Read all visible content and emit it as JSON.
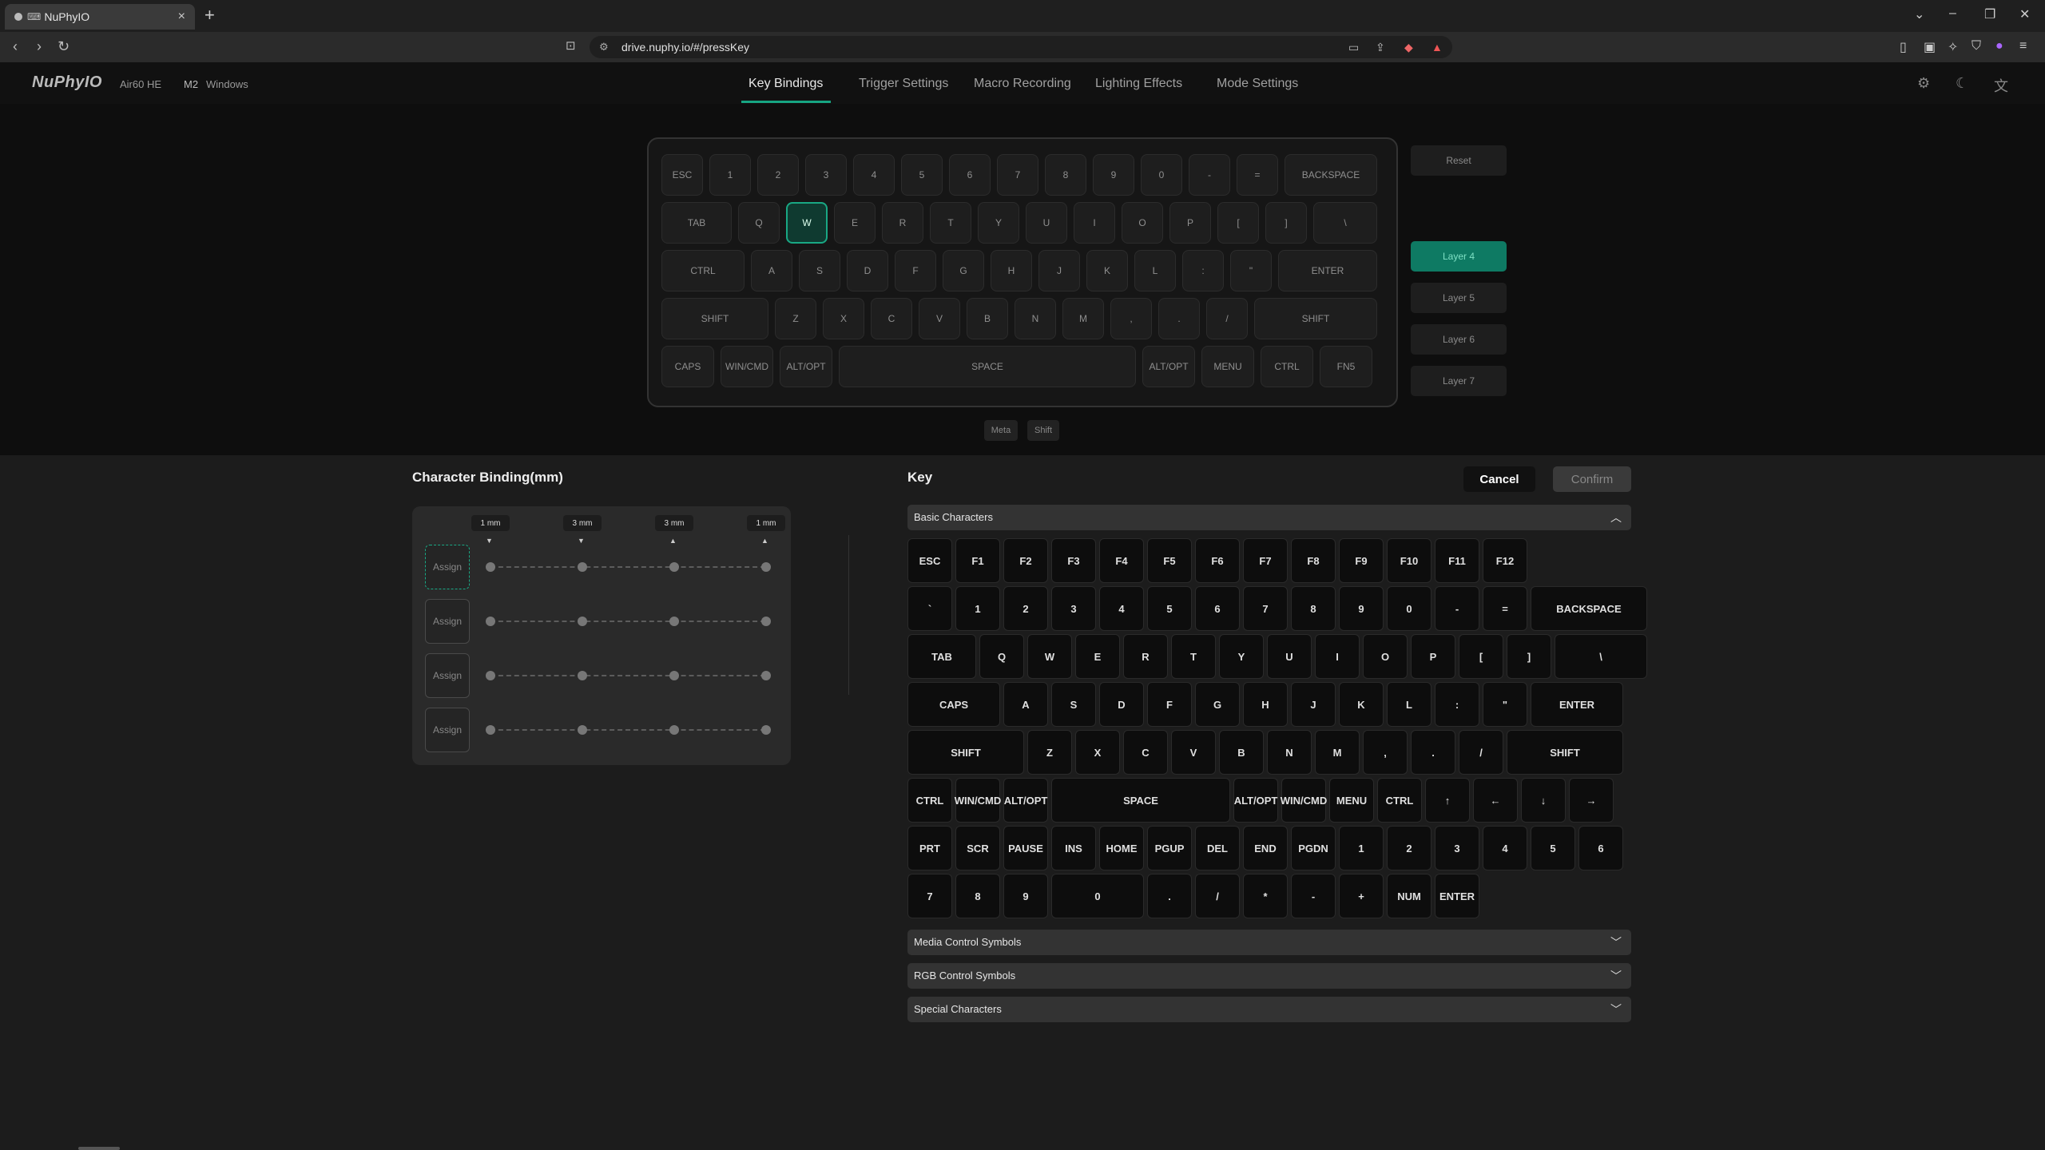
{
  "browser": {
    "tab_title": "NuPhyIO",
    "tab_kbd": "⌨",
    "url": "drive.nuphy.io/#/pressKey",
    "new_tab": "+",
    "close": "×"
  },
  "header": {
    "logo": "NuPhyIO",
    "model": "Air60 HE",
    "badge": "M2",
    "os": "Windows",
    "tabs": [
      "Key Bindings",
      "Trigger Settings",
      "Macro Recording",
      "Lighting Effects",
      "Mode Settings"
    ]
  },
  "top_keyboard": {
    "rows": [
      [
        "ESC",
        "1",
        "2",
        "3",
        "4",
        "5",
        "6",
        "7",
        "8",
        "9",
        "0",
        "-",
        "=",
        "BACKSPACE"
      ],
      [
        "TAB",
        "Q",
        "W",
        "E",
        "R",
        "T",
        "Y",
        "U",
        "I",
        "O",
        "P",
        "[",
        "]",
        "\\"
      ],
      [
        "CTRL",
        "A",
        "S",
        "D",
        "F",
        "G",
        "H",
        "J",
        "K",
        "L",
        ":",
        "\"",
        "ENTER"
      ],
      [
        "SHIFT",
        "Z",
        "X",
        "C",
        "V",
        "B",
        "N",
        "M",
        ",",
        ".",
        "/",
        "SHIFT"
      ],
      [
        "CAPS",
        "WIN/CMD",
        "ALT/OPT",
        "SPACE",
        "ALT/OPT",
        "MENU",
        "CTRL",
        "FN5"
      ]
    ],
    "selected": "W"
  },
  "side": {
    "reset": "Reset",
    "layers": [
      "Layer 4",
      "Layer 5",
      "Layer 6",
      "Layer 7"
    ]
  },
  "modifiers": [
    "Meta",
    "Shift"
  ],
  "binding": {
    "title": "Character Binding(mm)",
    "mm_labels": [
      "1 mm",
      "3 mm",
      "3 mm",
      "1 mm"
    ],
    "assign_label": "Assign",
    "slots": 4
  },
  "key": {
    "title": "Key",
    "cancel": "Cancel",
    "confirm": "Confirm",
    "sections": [
      "Basic Characters",
      "Media Control Symbols",
      "RGB Control Symbols",
      "Special Characters"
    ],
    "basic_rows": [
      [
        "ESC",
        "F1",
        "F2",
        "F3",
        "F4",
        "F5",
        "F6",
        "F7",
        "F8",
        "F9",
        "F10",
        "F11",
        "F12"
      ],
      [
        "`",
        "1",
        "2",
        "3",
        "4",
        "5",
        "6",
        "7",
        "8",
        "9",
        "0",
        "-",
        "=",
        "BACKSPACE"
      ],
      [
        "TAB",
        "Q",
        "W",
        "E",
        "R",
        "T",
        "Y",
        "U",
        "I",
        "O",
        "P",
        "[",
        "]",
        "\\"
      ],
      [
        "CAPS",
        "A",
        "S",
        "D",
        "F",
        "G",
        "H",
        "J",
        "K",
        "L",
        ":",
        "\"",
        "ENTER"
      ],
      [
        "SHIFT",
        "Z",
        "X",
        "C",
        "V",
        "B",
        "N",
        "M",
        ",",
        ".",
        "/",
        "SHIFT"
      ],
      [
        "CTRL",
        "WIN/CMD",
        "ALT/OPT",
        "SPACE",
        "ALT/OPT",
        "WIN/CMD",
        "MENU",
        "CTRL",
        "↑",
        "←",
        "↓",
        "→"
      ],
      [
        "PRT",
        "SCR",
        "PAUSE",
        "INS",
        "HOME",
        "PGUP",
        "DEL",
        "END",
        "PGDN",
        "1",
        "2",
        "3",
        "4",
        "5",
        "6"
      ],
      [
        "7",
        "8",
        "9",
        "0",
        ".",
        "/",
        "*",
        "-",
        "+",
        "NUM",
        "ENTER"
      ]
    ]
  }
}
